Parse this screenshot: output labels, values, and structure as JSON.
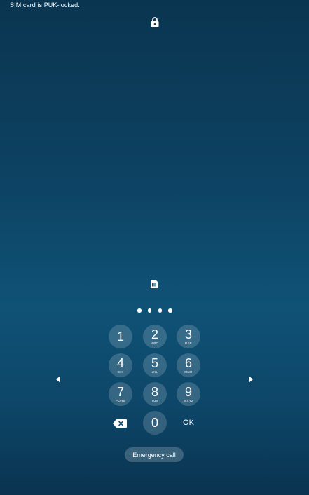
{
  "status": {
    "message": "SIM card is PUK-locked."
  },
  "icons": {
    "lock": "lock-icon",
    "sim": "sim-card-icon",
    "backspace": "backspace-icon",
    "left": "arrow-left-icon",
    "right": "arrow-right-icon"
  },
  "pin": {
    "entered_count": 4
  },
  "keypad": {
    "keys": [
      {
        "digit": "1",
        "letters": ""
      },
      {
        "digit": "2",
        "letters": "ABC"
      },
      {
        "digit": "3",
        "letters": "DEF"
      },
      {
        "digit": "4",
        "letters": "GHI"
      },
      {
        "digit": "5",
        "letters": "JKL"
      },
      {
        "digit": "6",
        "letters": "MNO"
      },
      {
        "digit": "7",
        "letters": "PQRS"
      },
      {
        "digit": "8",
        "letters": "TUV"
      },
      {
        "digit": "9",
        "letters": "WXYZ"
      },
      {
        "digit": "0",
        "letters": ""
      }
    ],
    "ok_label": "OK"
  },
  "emergency": {
    "label": "Emergency call"
  },
  "colors": {
    "background_top": "#0a3550",
    "background_mid": "#0f5276",
    "key_fill": "rgba(255,255,255,0.17)",
    "text": "#ffffff"
  }
}
